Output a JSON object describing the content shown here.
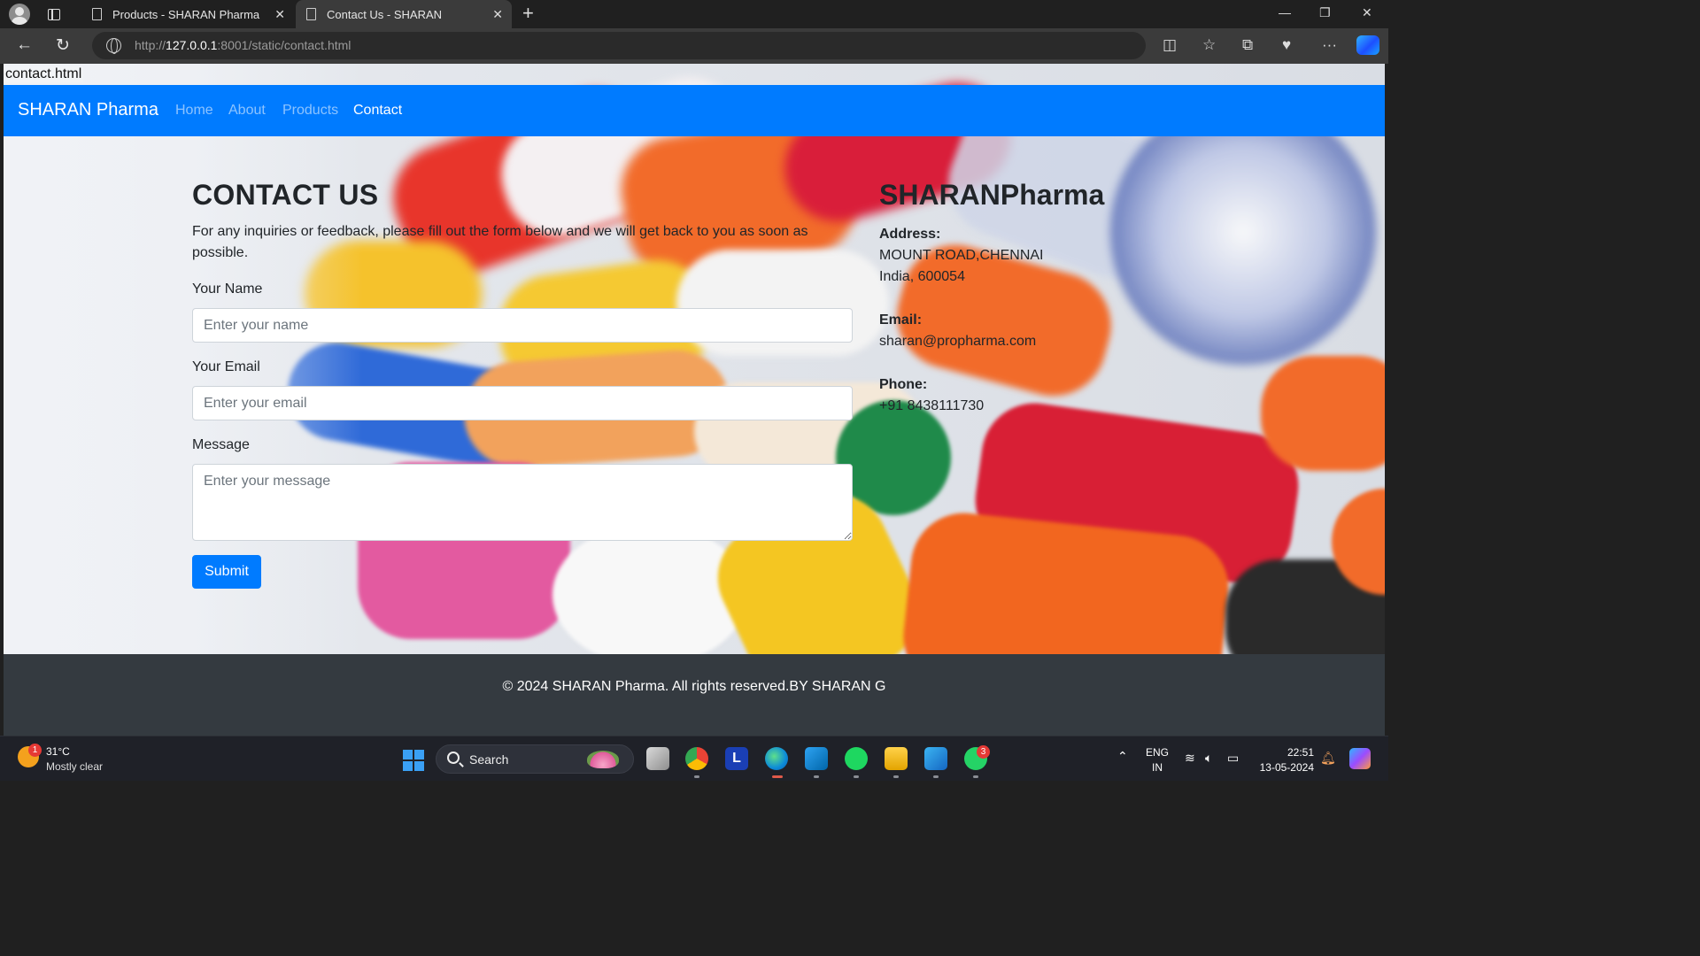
{
  "browser": {
    "tabs": [
      {
        "title": "Products - SHARAN Pharma",
        "active": false
      },
      {
        "title": "Contact Us - SHARAN",
        "active": true
      }
    ],
    "url_prefix": "http://",
    "url_host": "127.0.0.1",
    "url_rest": ":8001/static/contact.html"
  },
  "page": {
    "file_label": "contact.html",
    "navbar": {
      "brand": "SHARAN Pharma",
      "links": [
        {
          "label": "Home",
          "active": false
        },
        {
          "label": "About",
          "active": false
        },
        {
          "label": "Products",
          "active": false
        },
        {
          "label": "Contact",
          "active": true
        }
      ],
      "bg_color": "#007bff"
    },
    "contact": {
      "heading": "CONTACT US",
      "intro": "For any inquiries or feedback, please fill out the form below and we will get back to you as soon as possible.",
      "name_label": "Your Name",
      "name_placeholder": "Enter your name",
      "email_label": "Your Email",
      "email_placeholder": "Enter your email",
      "message_label": "Message",
      "message_placeholder": "Enter your message",
      "submit_label": "Submit"
    },
    "info": {
      "heading": "SHARANPharma",
      "address_label": "Address:",
      "address_line1": "MOUNT ROAD,CHENNAI",
      "address_line2": "India, 600054",
      "email_label": "Email:",
      "email_value": "sharan@propharma.com",
      "phone_label": "Phone:",
      "phone_value": "+91 8438111730"
    },
    "footer": "© 2024 SHARAN Pharma. All rights reserved.BY SHARAN G"
  },
  "taskbar": {
    "weather_temp": "31°C",
    "weather_desc": "Mostly clear",
    "weather_badge": "1",
    "search_label": "Search",
    "whatsapp_badge": "3",
    "lang_line1": "ENG",
    "lang_line2": "IN",
    "time": "22:51",
    "date": "13-05-2024"
  }
}
